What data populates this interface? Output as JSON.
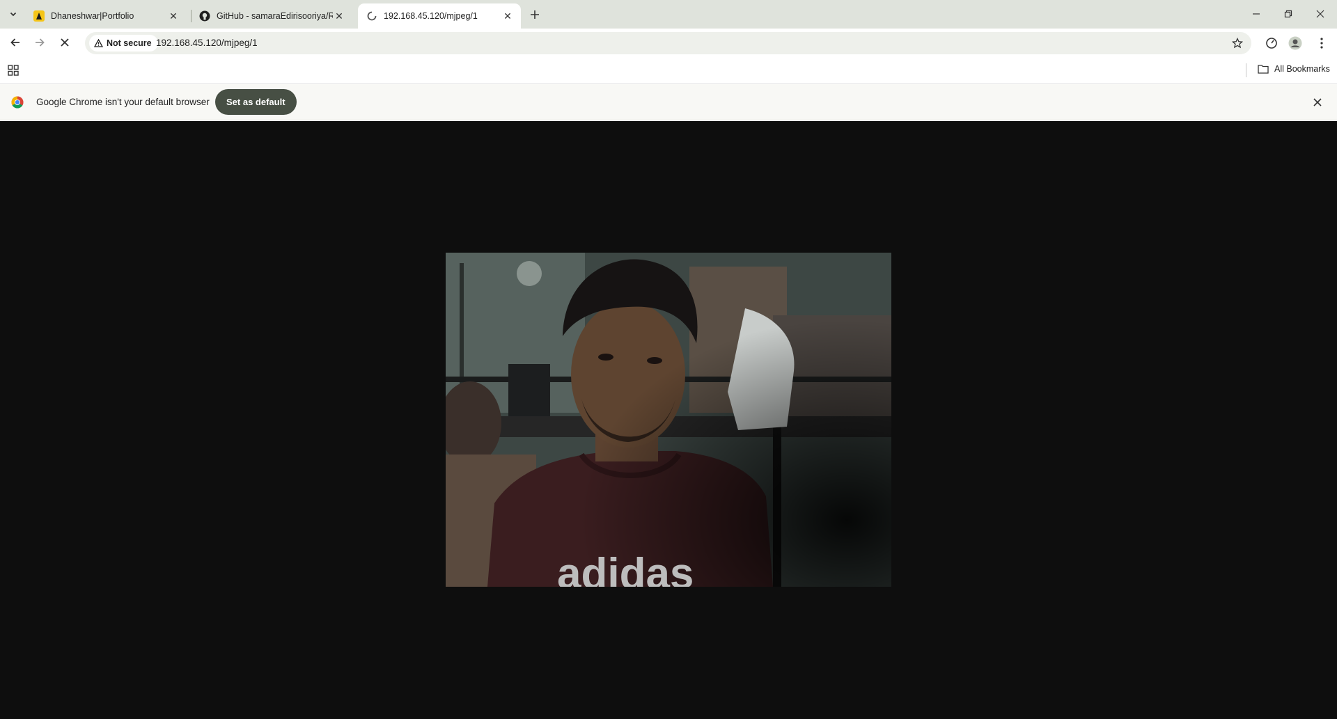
{
  "tabs": [
    {
      "title": "Dhaneshwar|Portfolio",
      "icon": "portfolio-favicon-icon",
      "active": false
    },
    {
      "title": "GitHub - samaraEdirisooriya/RU",
      "icon": "github-favicon-icon",
      "active": false
    },
    {
      "title": "192.168.45.120/mjpeg/1",
      "icon": "loading-spinner-icon",
      "active": true
    }
  ],
  "toolbar": {
    "security_label": "Not secure",
    "url": "192.168.45.120/mjpeg/1"
  },
  "bookmarks": {
    "all_bookmarks_label": "All Bookmarks"
  },
  "infobar": {
    "message": "Google Chrome isn't your default browser",
    "button_label": "Set as default"
  },
  "stream": {
    "shirt_text": "adidas"
  },
  "colors": {
    "tabstrip_bg": "#dfe3dc",
    "page_bg": "#0e0e0e",
    "button_bg": "#474f44"
  }
}
